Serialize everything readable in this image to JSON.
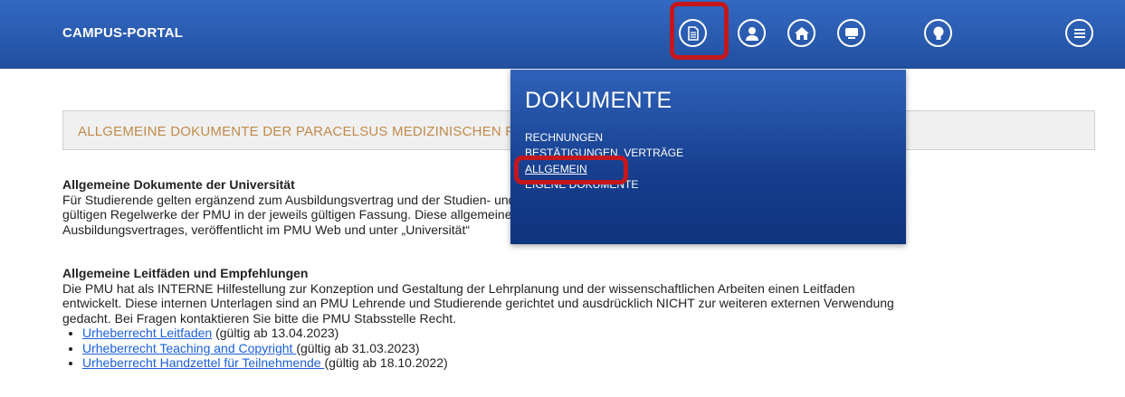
{
  "header": {
    "title": "CAMPUS-PORTAL",
    "icons": [
      "document-icon",
      "user-icon",
      "home-icon",
      "monitor-icon",
      "lightbulb-icon",
      "menu-icon"
    ]
  },
  "page_heading": "ALLGEMEINE DOKUMENTE DER PARACELSUS MEDIZINISCHEN PRIVATUNIVERSITÄT",
  "section1": {
    "title": "Allgemeine Dokumente der Universität",
    "lines": [
      "Für Studierende gelten ergänzend zum Ausbildungsvertrag und der Studien- und Prüfungsordnung des jeweiligen Studiengangs die allgemein",
      "gültigen Regelwerke der PMU in der jeweils gültigen Fassung. Diese allgemeinen Dokumente der Universität sind integrierte Bestandteile des",
      "Ausbildungsvertrages, veröffentlicht im PMU Web und unter „Universität“"
    ]
  },
  "section2": {
    "title": "Allgemeine Leitfäden und Empfehlungen",
    "lines": [
      "Die PMU hat als INTERNE Hilfestellung zur Konzeption und Gestaltung der Lehrplanung und der wissenschaftlichen Arbeiten einen Leitfaden",
      "entwickelt. Diese internen Unterlagen sind an PMU Lehrende und Studierende gerichtet und ausdrücklich NICHT zur weiteren externen Verwendung",
      "gedacht. Bei Fragen kontaktieren Sie bitte die PMU Stabsstelle Recht."
    ],
    "items": [
      {
        "link": "Urheberrecht Leitfaden",
        "note": " (gültig ab 13.04.2023)"
      },
      {
        "link": "Urheberrecht Teaching and Copyright ",
        "note": "(gültig ab 31.03.2023)"
      },
      {
        "link": "Urheberrecht Handzettel für Teilnehmende ",
        "note": "(gültig ab 18.10.2022)"
      }
    ]
  },
  "dropdown": {
    "title": "DOKUMENTE",
    "items": [
      "RECHNUNGEN",
      "BESTÄTIGUNGEN, VERTRÄGE",
      "ALLGEMEIN",
      "EIGENE DOKUMENTE"
    ]
  },
  "colors": {
    "header_bg": "#2a5bb0",
    "dropdown_bg": "#163e8d",
    "highlight": "#c4171c",
    "heading_text": "#c08a4a",
    "link": "#1a5fd6"
  }
}
